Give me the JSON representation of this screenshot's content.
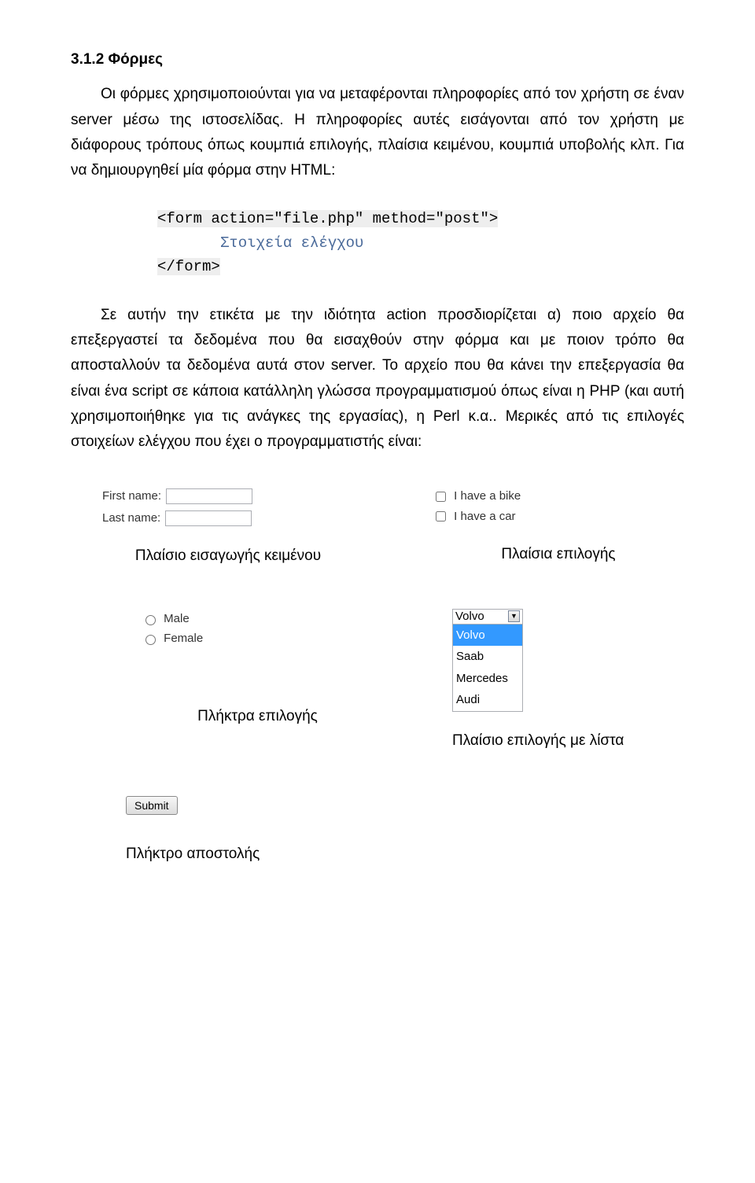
{
  "heading": "3.1.2 Φόρμες",
  "para1": "Οι φόρμες χρησιμοποιούνται για να μεταφέρονται πληροφορίες από τον χρήστη σε έναν server μέσω της ιστοσελίδας. Η πληροφορίες αυτές εισάγονται από τον χρήστη με διάφορους τρόπους όπως κουμπιά επιλογής, πλαίσια κειμένου, κουμπιά υποβολής κλπ. Για να δημιουργηθεί μία φόρμα στην HTML:",
  "code": {
    "open": "<form action=\"file.php\" method=\"post\">",
    "inner": "Στοιχεία ελέγχου",
    "close": "</form>"
  },
  "para2": "Σε αυτήν την ετικέτα με την ιδιότητα action προσδιορίζεται α) ποιο αρχείο θα επεξεργαστεί τα δεδομένα που θα εισαχθούν στην φόρμα και με ποιον τρόπο θα αποσταλλούν τα δεδομένα αυτά στον server. Το αρχείο που θα κάνει την επεξεργασία θα είναι ένα script σε κάποια κατάλληλη γλώσσα προγραμματισμού όπως είναι η PHP (και αυτή χρησιμοποιήθηκε για τις ανάγκες της εργασίας), η Perl κ.α.. Μερικές από τις επιλογές στοιχείων ελέγχου που έχει ο προγραμματιστής είναι:",
  "textInputs": {
    "label1": "First name:",
    "label2": "Last name:"
  },
  "checkboxes": {
    "opt1": "I have a bike",
    "opt2": "I have a car"
  },
  "captions": {
    "text": "Πλαίσιο εισαγωγής κειμένου",
    "check": "Πλαίσια επιλογής",
    "radio": "Πλήκτρα επιλογής",
    "select": "Πλαίσιο επιλογής με λίστα",
    "submit": "Πλήκτρο αποστολής"
  },
  "radios": {
    "opt1": "Male",
    "opt2": "Female"
  },
  "select": {
    "selected": "Volvo",
    "options": [
      "Volvo",
      "Saab",
      "Mercedes",
      "Audi"
    ]
  },
  "submitLabel": "Submit"
}
